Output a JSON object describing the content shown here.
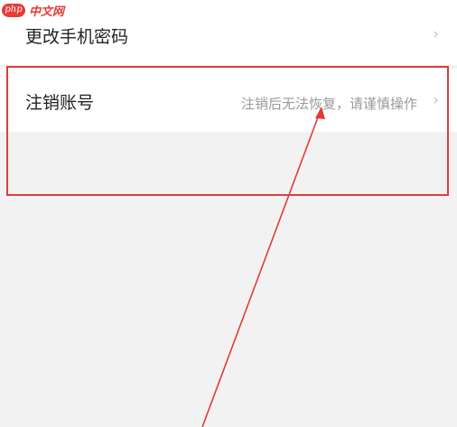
{
  "watermark": {
    "logo_text": "php",
    "site_text": "中文网"
  },
  "settings": {
    "rows": [
      {
        "label": "更改手机密码",
        "hint": "",
        "icon": "chevron-right-icon"
      },
      {
        "label": "注销账号",
        "hint": "注销后无法恢复，请谨慎操作",
        "icon": "chevron-right-icon"
      }
    ]
  },
  "colors": {
    "background": "#f2f2f2",
    "row_background": "#ffffff",
    "annotation": "#e23b3b",
    "hint_text": "#9a9a9a",
    "chevron": "#c4c4c4"
  }
}
